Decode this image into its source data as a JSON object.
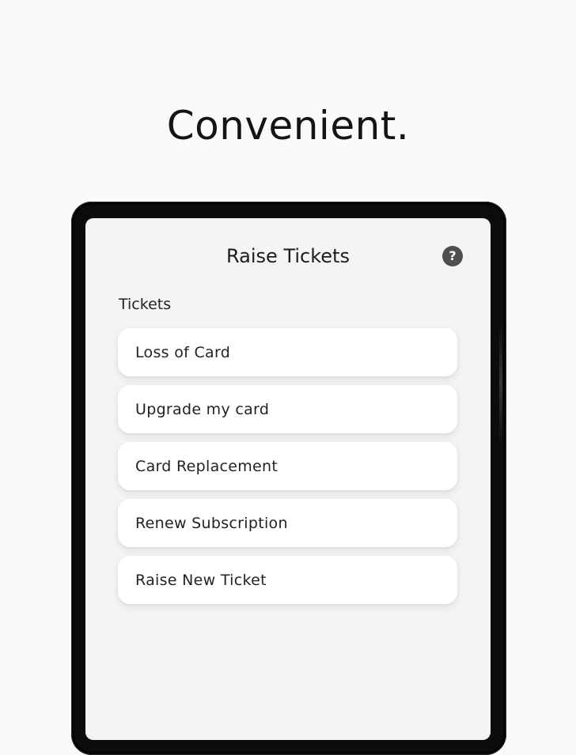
{
  "hero": {
    "headline": "Convenient."
  },
  "screen": {
    "title": "Raise Tickets",
    "help_icon_glyph": "?",
    "help_icon": "help-circle-icon",
    "section_label": "Tickets",
    "tickets": [
      {
        "label": "Loss of Card"
      },
      {
        "label": "Upgrade my card"
      },
      {
        "label": "Card Replacement"
      },
      {
        "label": "Renew Subscription"
      },
      {
        "label": "Raise New Ticket"
      }
    ]
  },
  "colors": {
    "page_background": "#fbf9fa",
    "device_frame": "#0c0c0c",
    "screen_background": "#f3f4f6",
    "card_background": "#ffffff",
    "help_icon": "#4f4f4f"
  }
}
